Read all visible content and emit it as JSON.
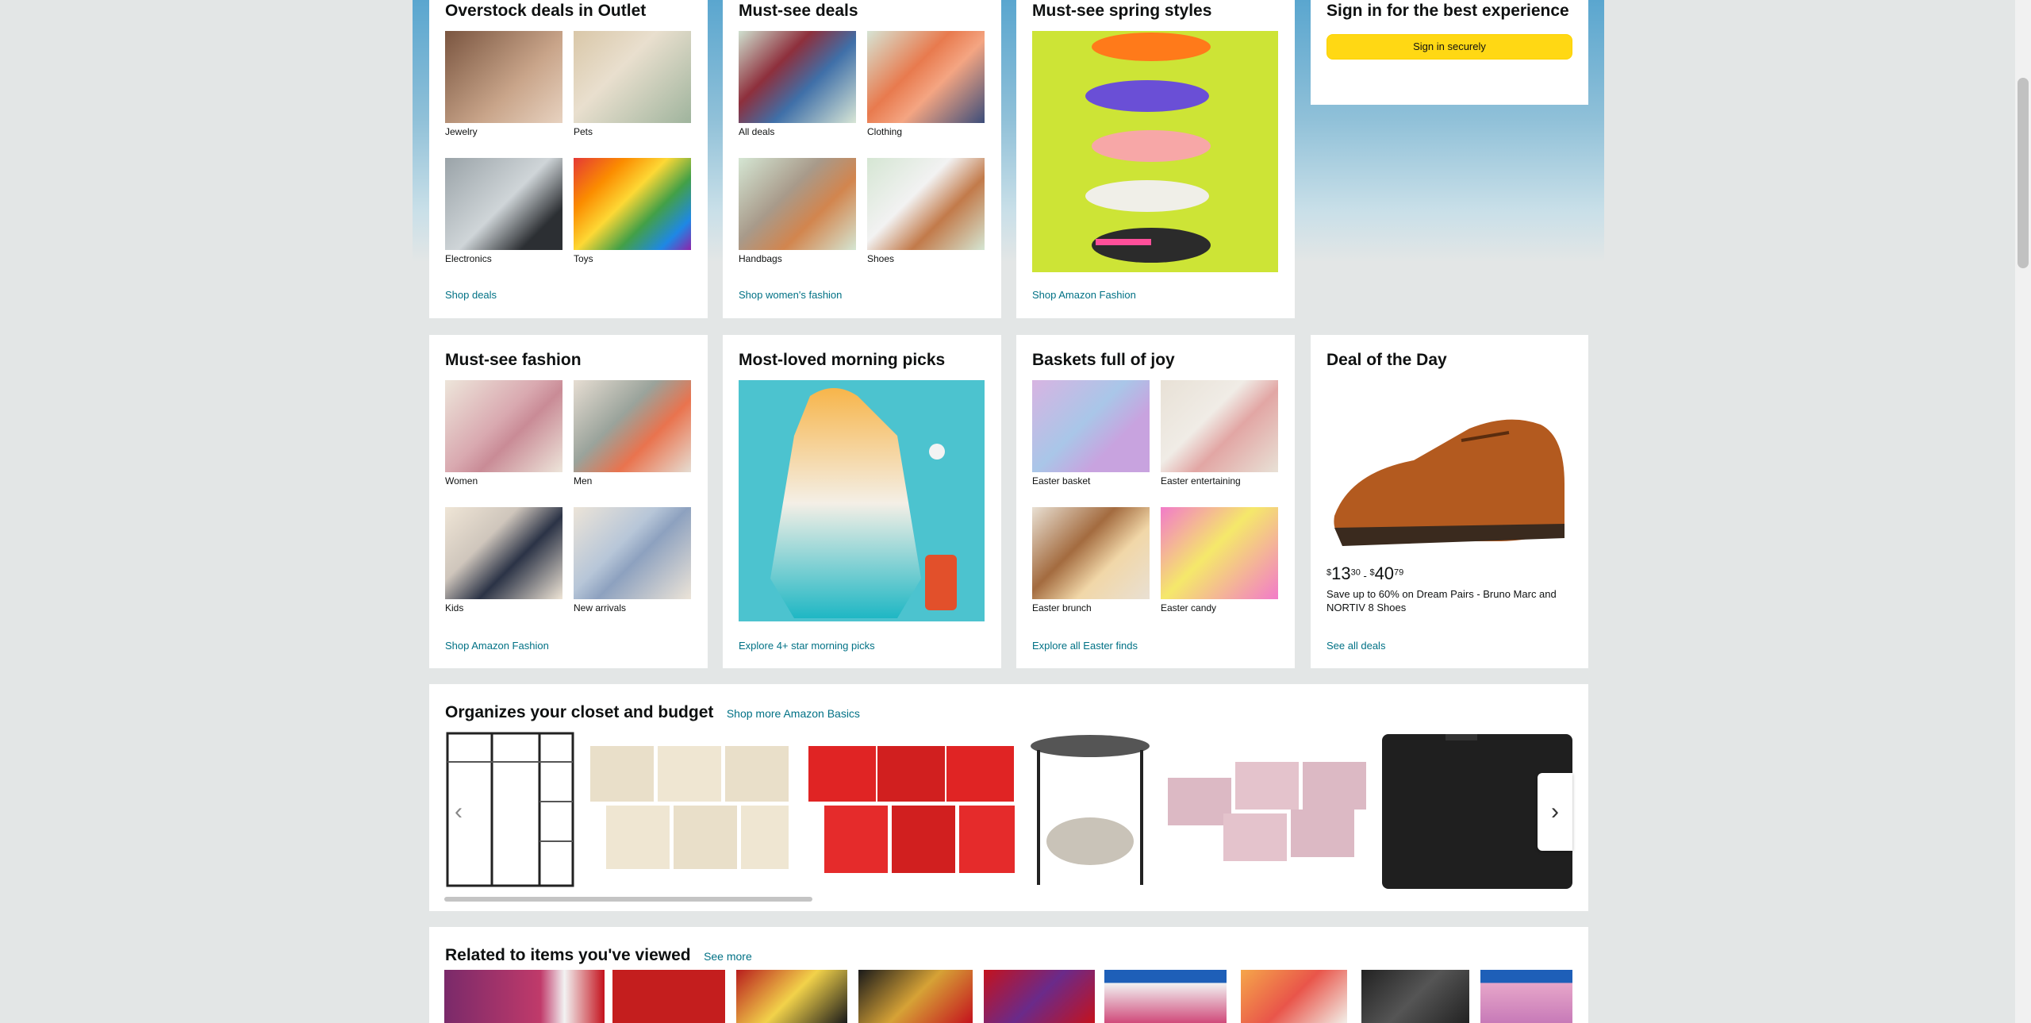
{
  "cards_row1": [
    {
      "title": "Overstock deals in Outlet",
      "items": [
        "Jewelry",
        "Pets",
        "Electronics",
        "Toys"
      ],
      "link": "Shop deals"
    },
    {
      "title": "Must-see deals",
      "items": [
        "All deals",
        "Clothing",
        "Handbags",
        "Shoes"
      ],
      "link": "Shop women's fashion"
    },
    {
      "title": "Must-see spring styles",
      "link": "Shop Amazon Fashion"
    },
    {
      "title": "Sign in for the best experience",
      "button": "Sign in securely"
    }
  ],
  "cards_row2": [
    {
      "title": "Must-see fashion",
      "items": [
        "Women",
        "Men",
        "Kids",
        "New arrivals"
      ],
      "link": "Shop Amazon Fashion"
    },
    {
      "title": "Most-loved morning picks",
      "link": "Explore 4+ star morning picks"
    },
    {
      "title": "Baskets full of joy",
      "items": [
        "Easter basket",
        "Easter entertaining",
        "Easter brunch",
        "Easter candy"
      ],
      "link": "Explore all Easter finds"
    },
    {
      "title": "Deal of the Day",
      "price_low_dollars": "13",
      "price_low_cents": "30",
      "price_high_dollars": "40",
      "price_high_cents": "79",
      "description": "Save up to 60% on Dream Pairs - Bruno Marc and NORTIV 8 Shoes",
      "link": "See all deals"
    }
  ],
  "closet": {
    "title": "Organizes your closet and budget",
    "link": "Shop more Amazon Basics",
    "prev_icon": "‹",
    "next_icon": "›"
  },
  "related": {
    "title": "Related to items you've viewed",
    "link": "See more"
  },
  "colors": {
    "link": "#007185",
    "button": "#ffd814",
    "page_bg": "#e3e6e6"
  }
}
